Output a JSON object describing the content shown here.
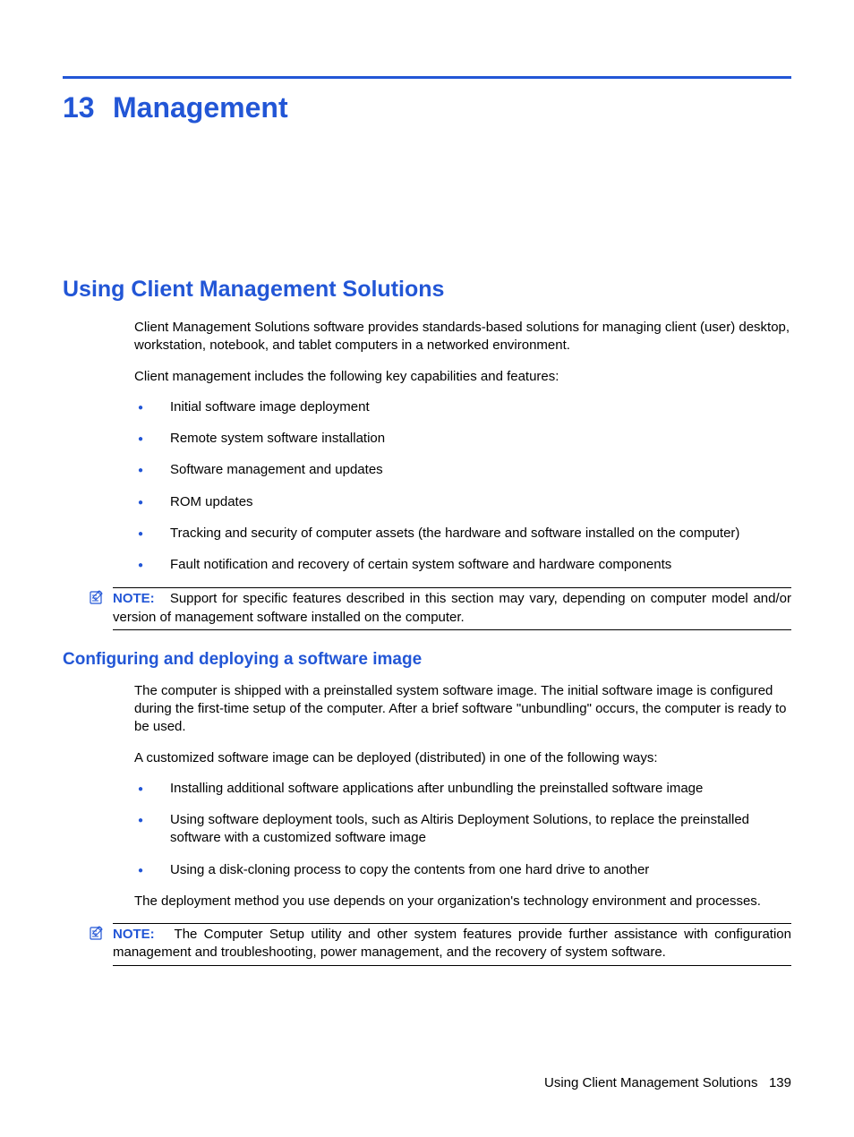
{
  "chapter": {
    "number": "13",
    "title": "Management"
  },
  "section1": {
    "heading": "Using Client Management Solutions",
    "para1": "Client Management Solutions software provides standards-based solutions for managing client (user) desktop, workstation, notebook, and tablet computers in a networked environment.",
    "para2": "Client management includes the following key capabilities and features:",
    "bullets": [
      "Initial software image deployment",
      "Remote system software installation",
      "Software management and updates",
      "ROM updates",
      "Tracking and security of computer assets (the hardware and software installed on the computer)",
      "Fault notification and recovery of certain system software and hardware components"
    ],
    "note": {
      "label": "NOTE:",
      "text": "Support for specific features described in this section may vary, depending on computer model and/or version of management software installed on the computer."
    }
  },
  "section2": {
    "heading": "Configuring and deploying a software image",
    "para1": "The computer is shipped with a preinstalled system software image. The initial software image is configured during the first-time setup of the computer. After a brief software \"unbundling\" occurs, the computer is ready to be used.",
    "para2": "A customized software image can be deployed (distributed) in one of the following ways:",
    "bullets": [
      "Installing additional software applications after unbundling the preinstalled software image",
      "Using software deployment tools, such as Altiris Deployment Solutions, to replace the preinstalled software with a customized software image",
      "Using a disk-cloning process to copy the contents from one hard drive to another"
    ],
    "para3": "The deployment method you use depends on your organization's technology environment and processes.",
    "note": {
      "label": "NOTE:",
      "text": "The Computer Setup utility and other system features provide further assistance with configuration management and troubleshooting, power management, and the recovery of system software."
    }
  },
  "footer": {
    "text": "Using Client Management Solutions",
    "page": "139"
  }
}
